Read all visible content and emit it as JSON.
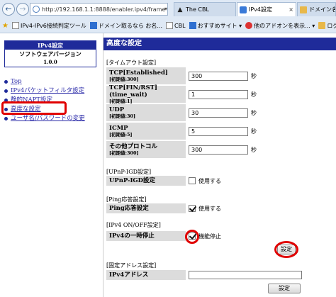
{
  "browser": {
    "url": "http://192.168.1.1:8888/enabler.ipv4/frame",
    "tabs": [
      {
        "label": "The CBL",
        "icon": "cbl-favicon"
      },
      {
        "label": "IPv4設定",
        "icon": "page-favicon",
        "active": true
      },
      {
        "label": "ドメイン名",
        "icon": "folder-favicon"
      }
    ],
    "favorites": [
      "IPv4-IPv6接続判定ツール",
      "ドメイン取るなら お名...",
      "CBL",
      "おすすめサイト ▾",
      "他のアドオンを表示... ▾",
      "ログイン"
    ]
  },
  "sidebar": {
    "box_title": "IPv4設定",
    "version_label": "ソフトウェアバージョン",
    "version": "1.0.0",
    "menu": [
      "Top",
      "IPv4パケットフィルタ設定",
      "静的NAPT設定",
      "高度な設定",
      "ユーザ名/パスワードの変更"
    ]
  },
  "main": {
    "title": "高度な設定",
    "timeout": {
      "section": "[タイムアウト設定]",
      "rows": [
        {
          "label": "TCP[Established]",
          "default": "[初期値:300]",
          "value": "300",
          "unit": "秒"
        },
        {
          "label": "TCP[FIN/RST](time_wait)",
          "default": "[初期値:1]",
          "value": "1",
          "unit": "秒"
        },
        {
          "label": "UDP",
          "default": "[初期値:30]",
          "value": "30",
          "unit": "秒"
        },
        {
          "label": "ICMP",
          "default": "[初期値:5]",
          "value": "5",
          "unit": "秒"
        },
        {
          "label": "その他プロトコル",
          "default": "[初期値:300]",
          "value": "300",
          "unit": "秒"
        }
      ]
    },
    "upnp": {
      "section": "[UPnP-IGD設定]",
      "label": "UPnP-IGD設定",
      "option": "使用する",
      "checked": false
    },
    "ping": {
      "section": "[Ping応答設定]",
      "label": "Ping応答設定",
      "option": "使用する",
      "checked": true
    },
    "onoff": {
      "section": "[IPv4 ON/OFF設定]",
      "label": "IPv4の一時停止",
      "option": "機能停止",
      "checked": true,
      "button": "設定"
    },
    "fixed": {
      "section": "[固定アドレス設定]",
      "label": "IPv4アドレス",
      "value": "",
      "button": "設定"
    }
  }
}
